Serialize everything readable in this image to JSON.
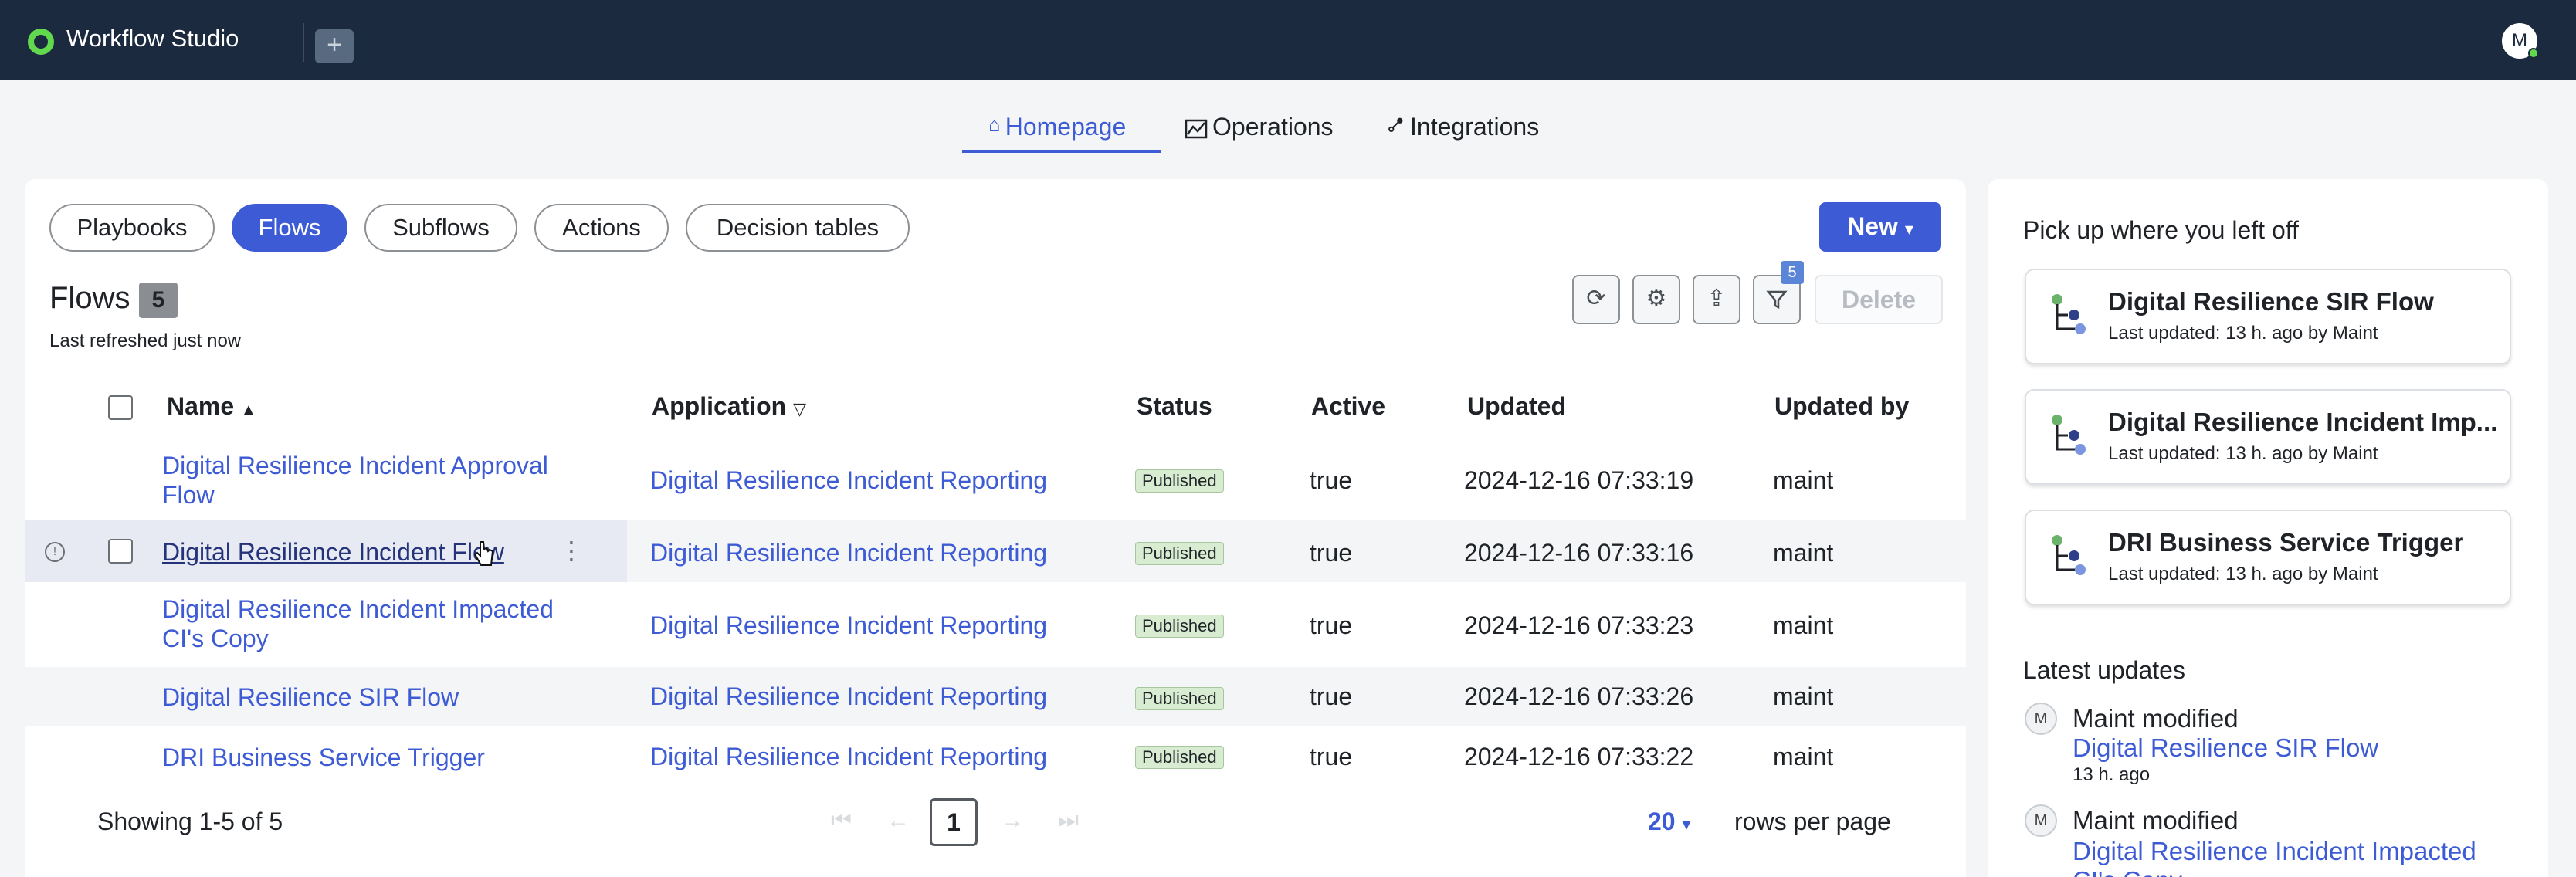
{
  "topbar": {
    "app_title": "Workflow Studio",
    "add_tab_icon": "+",
    "avatar_initial": "M"
  },
  "nav": {
    "tabs": [
      {
        "label": "Homepage",
        "icon": "home-icon",
        "active": true
      },
      {
        "label": "Operations",
        "icon": "chart-icon",
        "active": false
      },
      {
        "label": "Integrations",
        "icon": "link-icon",
        "active": false
      }
    ]
  },
  "filters": {
    "pills": [
      "Playbooks",
      "Flows",
      "Subflows",
      "Actions",
      "Decision tables"
    ],
    "active": "Flows",
    "new_label": "New"
  },
  "list": {
    "title": "Flows",
    "count": "5",
    "refreshed": "Last refreshed just now",
    "filter_badge": "5",
    "delete_label": "Delete"
  },
  "table": {
    "headers": {
      "name": "Name",
      "application": "Application",
      "status": "Status",
      "active": "Active",
      "updated": "Updated",
      "updated_by": "Updated by"
    },
    "rows": [
      {
        "name": "Digital Resilience Incident Approval Flow",
        "application": "Digital Resilience Incident Reporting",
        "status": "Published",
        "active": "true",
        "updated": "2024-12-16 07:33:19",
        "updated_by": "maint"
      },
      {
        "name": "Digital Resilience Incident Flow",
        "application": "Digital Resilience Incident Reporting",
        "status": "Published",
        "active": "true",
        "updated": "2024-12-16 07:33:16",
        "updated_by": "maint"
      },
      {
        "name": "Digital Resilience Incident Impacted CI's Copy",
        "application": "Digital Resilience Incident Reporting",
        "status": "Published",
        "active": "true",
        "updated": "2024-12-16 07:33:23",
        "updated_by": "maint"
      },
      {
        "name": "Digital Resilience SIR Flow",
        "application": "Digital Resilience Incident Reporting",
        "status": "Published",
        "active": "true",
        "updated": "2024-12-16 07:33:26",
        "updated_by": "maint"
      },
      {
        "name": "DRI Business Service Trigger",
        "application": "Digital Resilience Incident Reporting",
        "status": "Published",
        "active": "true",
        "updated": "2024-12-16 07:33:22",
        "updated_by": "maint"
      }
    ]
  },
  "pagination": {
    "showing": "Showing 1-5 of 5",
    "current_page": "1",
    "rows_per_page_value": "20",
    "rows_per_page_label": "rows per page"
  },
  "side": {
    "pickup_heading": "Pick up where you left off",
    "recent": [
      {
        "title": "Digital Resilience SIR Flow",
        "sub": "Last updated: 13 h. ago by Maint"
      },
      {
        "title": "Digital Resilience Incident Imp...",
        "sub": "Last updated: 13 h. ago by Maint"
      },
      {
        "title": "DRI Business Service Trigger",
        "sub": "Last updated: 13 h. ago by Maint"
      }
    ],
    "latest_heading": "Latest updates",
    "updates": [
      {
        "avatar": "M",
        "who": "Maint modified",
        "link": "Digital Resilience SIR Flow",
        "time": "13 h. ago"
      },
      {
        "avatar": "M",
        "who": "Maint modified",
        "link": "Digital Resilience Incident Impacted",
        "link2": "CI's Copy"
      }
    ]
  },
  "colors": {
    "topbar": "#1b2a3e",
    "accent": "#3e5bd6",
    "logo": "#62d84e",
    "published_badge": "#d7ecd1"
  }
}
